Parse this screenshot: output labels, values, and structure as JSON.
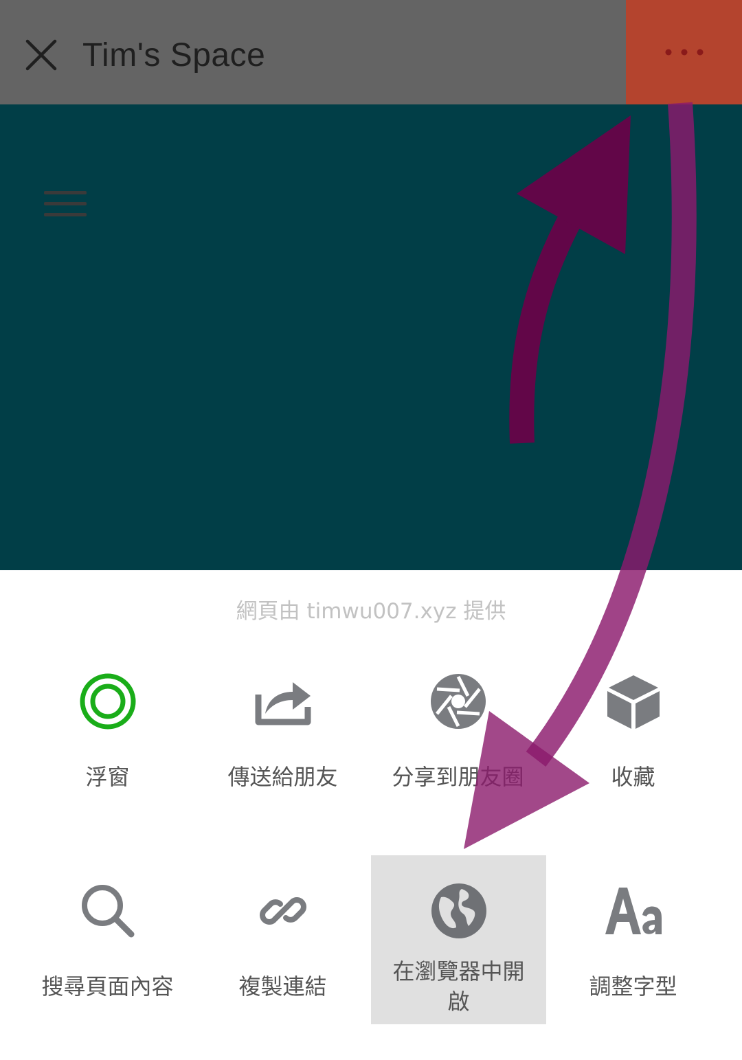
{
  "header": {
    "title": "Tim's Space",
    "close_icon": "close-icon",
    "more_icon": "more-dots-icon"
  },
  "content": {
    "menu_icon": "hamburger-icon",
    "background_color": "#013e47"
  },
  "sheet": {
    "provider_text": "網頁由 timwu007.xyz 提供",
    "items": [
      {
        "label": "浮窗",
        "icon": "floating-window-icon"
      },
      {
        "label": "傳送給朋友",
        "icon": "share-arrow-icon"
      },
      {
        "label": "分享到朋友圈",
        "icon": "moments-shutter-icon"
      },
      {
        "label": "收藏",
        "icon": "favorite-cube-icon"
      },
      {
        "label": "搜尋頁面內容",
        "icon": "search-icon"
      },
      {
        "label": "複製連結",
        "icon": "link-icon"
      },
      {
        "label": "在瀏覽器中開啟",
        "icon": "globe-icon",
        "selected": true
      },
      {
        "label": "調整字型",
        "icon": "font-aa-icon"
      }
    ]
  },
  "colors": {
    "topbar": "#646464",
    "more_highlight": "#b4442e",
    "annotation_arrow": "#8b1a6c",
    "icon_gray": "#7a7c80",
    "icon_green": "#1aad19"
  }
}
